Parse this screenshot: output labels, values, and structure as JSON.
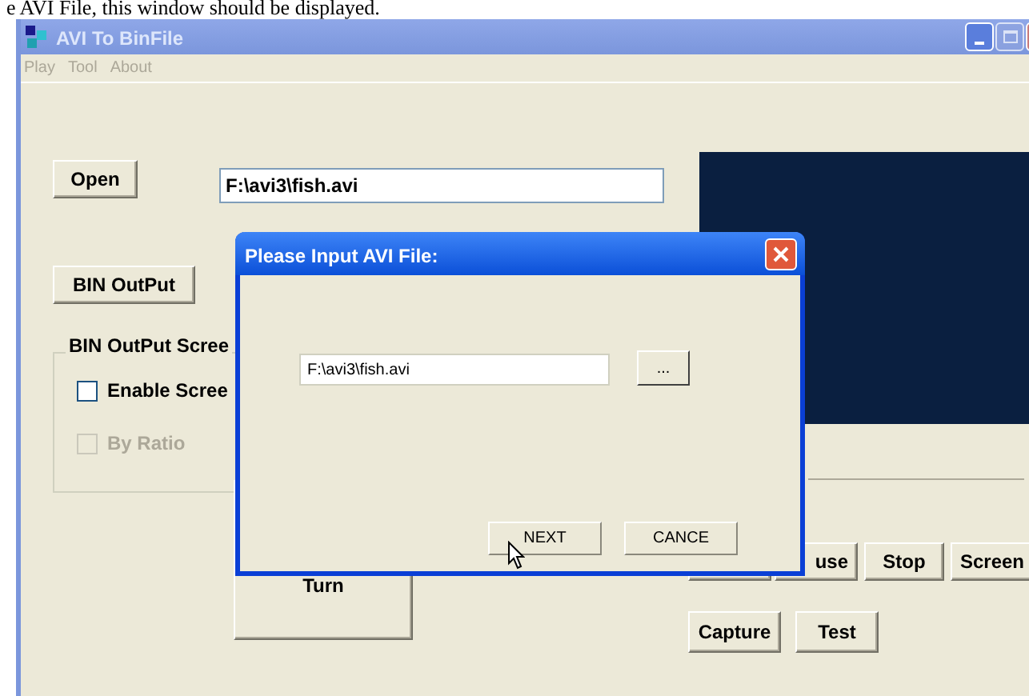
{
  "caption": "e AVI File, this window should be displayed.",
  "window": {
    "title": "AVI To BinFile",
    "maximize_disabled": true
  },
  "menu": [
    "Play",
    "Tool",
    "About"
  ],
  "open_button": "Open",
  "path_field": {
    "value": "F:\\avi3\\fish.avi"
  },
  "bin_output_button": "BIN OutPut",
  "group": {
    "title": "BIN OutPut Scree",
    "options": [
      {
        "label": "Enable Scree",
        "checked": false,
        "disabled": false
      },
      {
        "label": "By Ratio",
        "checked": false,
        "disabled": true
      }
    ]
  },
  "turn_button": "Turn",
  "playback_buttons": [
    "use",
    "Stop",
    "Screen"
  ],
  "bottom_buttons": [
    "Capture",
    "Test"
  ],
  "dialog": {
    "title": "Please Input AVI File:",
    "field": {
      "value": "F:\\avi3\\fish.avi"
    },
    "browse": "...",
    "buttons": [
      "NEXT",
      "CANCE"
    ]
  }
}
